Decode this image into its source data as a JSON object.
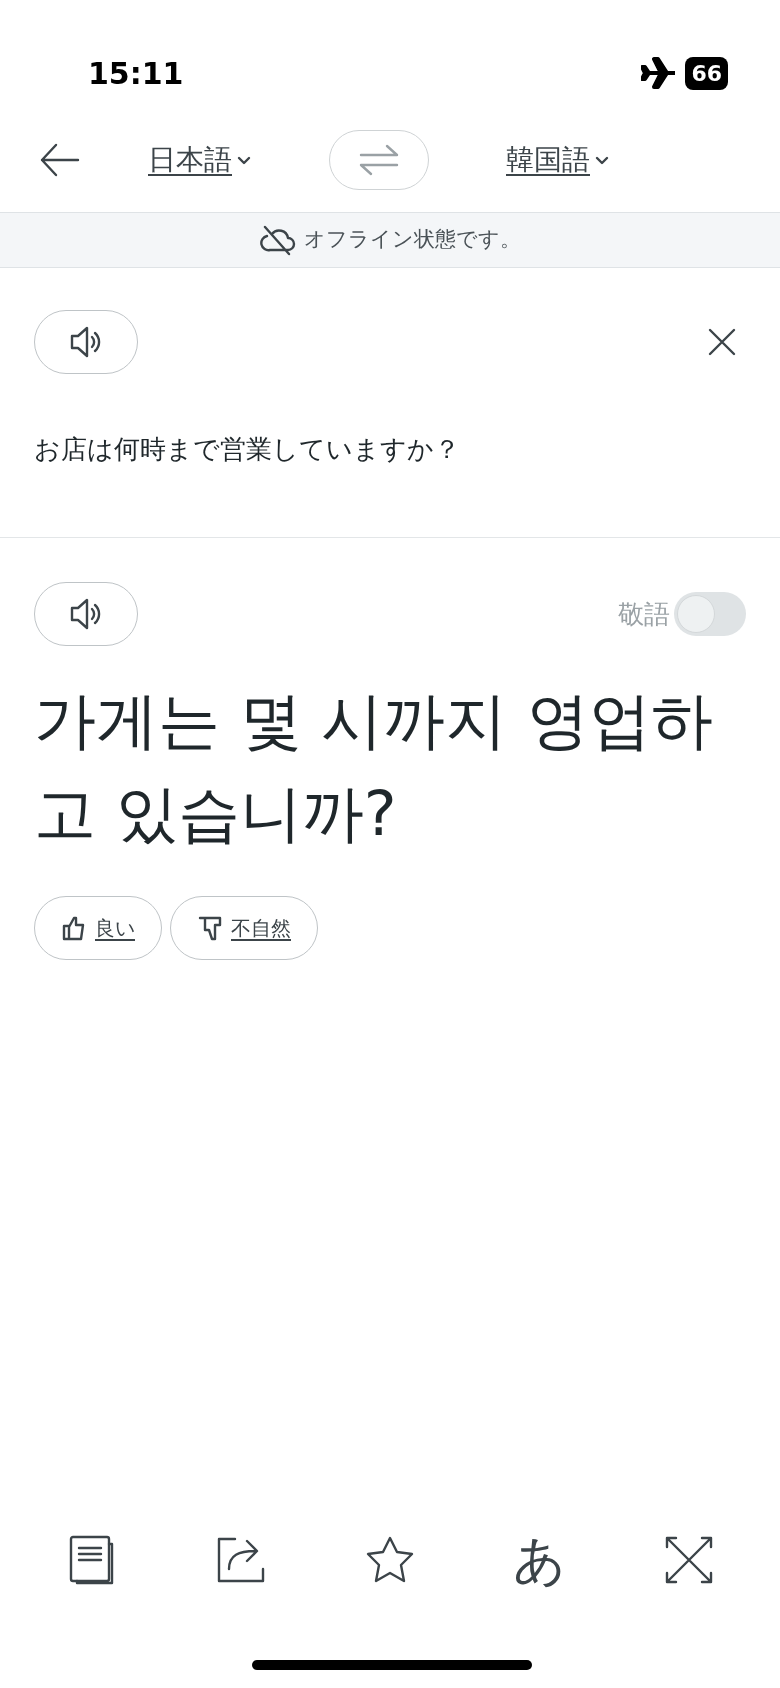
{
  "status_bar": {
    "time": "15:11",
    "battery": "66",
    "airplane_mode": true
  },
  "header": {
    "source_language": "日本語",
    "target_language": "韓国語"
  },
  "banner": {
    "text": "オフライン状態です。"
  },
  "source": {
    "text": "お店は何時まで営業していますか？"
  },
  "target": {
    "honorific_label": "敬語",
    "honorific_on": false,
    "text": "가게는 몇 시까지 영업하고 있습니까?"
  },
  "feedback": [
    {
      "kind": "good",
      "label": "良い"
    },
    {
      "kind": "bad",
      "label": "不自然"
    }
  ],
  "toolbar": [
    {
      "kind": "copy"
    },
    {
      "kind": "share"
    },
    {
      "kind": "favorite"
    },
    {
      "kind": "furigana",
      "glyph": "あ"
    },
    {
      "kind": "fullscreen"
    }
  ]
}
